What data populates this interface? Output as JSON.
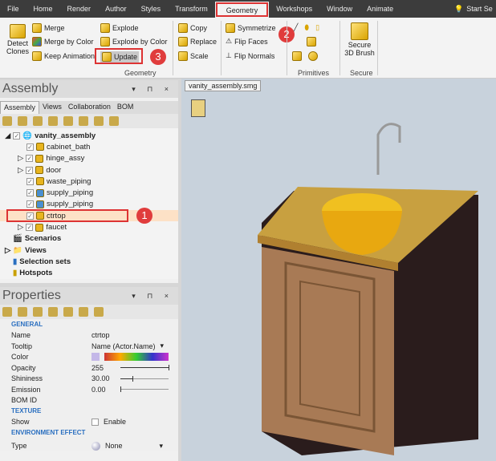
{
  "menu": {
    "tabs": [
      "File",
      "Home",
      "Render",
      "Author",
      "Styles",
      "Transform",
      "Geometry",
      "Workshops",
      "Window",
      "Animate"
    ],
    "search": "Start Se"
  },
  "ribbon": {
    "detect_clones": "Detect Clones",
    "merge": "Merge",
    "merge_by_color": "Merge by Color",
    "keep_animation": "Keep Animation",
    "explode": "Explode",
    "explode_by_color": "Explode by Color",
    "update": "Update",
    "copy": "Copy",
    "replace": "Replace",
    "scale": "Scale",
    "symmetrize": "Symmetrize",
    "flip_faces": "Flip Faces",
    "flip_normals": "Flip Normals",
    "secure_3d_brush": "Secure 3D Brush",
    "groups": {
      "geometry": "Geometry",
      "primitives": "Primitives",
      "secure": "Secure"
    }
  },
  "callouts": [
    "1",
    "2",
    "3"
  ],
  "assembly": {
    "title": "Assembly",
    "tabs": [
      "Assembly",
      "Views",
      "Collaboration",
      "BOM"
    ],
    "root": "vanity_assembly",
    "children": [
      "cabinet_bath",
      "hinge_assy",
      "door",
      "waste_piping",
      "supply_piping",
      "supply_piping",
      "ctrtop",
      "faucet"
    ],
    "sections": [
      "Scenarios",
      "Views",
      "Selection sets",
      "Hotspots"
    ]
  },
  "properties": {
    "title": "Properties",
    "general": "GENERAL",
    "rows": [
      {
        "k": "Name",
        "v": "ctrtop"
      },
      {
        "k": "Tooltip",
        "v": "Name (Actor.Name)"
      },
      {
        "k": "Color",
        "v": ""
      },
      {
        "k": "Opacity",
        "v": "255"
      },
      {
        "k": "Shininess",
        "v": "30.00"
      },
      {
        "k": "Emission",
        "v": "0.00"
      },
      {
        "k": "BOM ID",
        "v": ""
      }
    ],
    "texture": "TEXTURE",
    "show": "Show",
    "enable": "Enable",
    "env": "ENVIRONMENT EFFECT",
    "type": "Type",
    "type_value": "None",
    "sliders": {
      "opacity": 1.0,
      "shininess": 0.25,
      "emission": 0.0
    }
  },
  "viewport": {
    "tab": "vanity_assembly.smg"
  }
}
